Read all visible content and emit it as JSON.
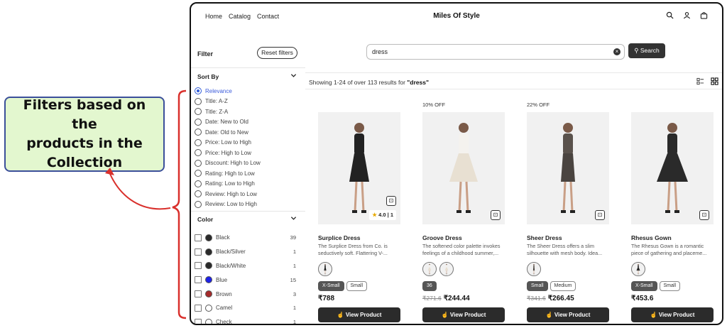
{
  "annotation": {
    "text": "Filters based on the\nproducts in the\nCollection"
  },
  "nav": {
    "links": [
      "Home",
      "Catalog",
      "Contact"
    ],
    "brand": "Miles Of Style"
  },
  "filter": {
    "label": "Filter",
    "reset": "Reset filters"
  },
  "search": {
    "query": "dress",
    "button": "Search"
  },
  "sort": {
    "title": "Sort By",
    "options": [
      "Relevance",
      "Title: A-Z",
      "Title: Z-A",
      "Date: New to Old",
      "Date: Old to New",
      "Price: Low to High",
      "Price: High to Low",
      "Discount: High to Low",
      "Rating: High to Low",
      "Rating: Low to High",
      "Review: High to Low",
      "Review: Low to High"
    ],
    "selected": "Relevance"
  },
  "color": {
    "title": "Color",
    "items": [
      {
        "name": "Black",
        "count": "39",
        "swatch": "#2a2a2a"
      },
      {
        "name": "Black/Silver",
        "count": "1",
        "swatch": "#2a2a2a"
      },
      {
        "name": "Black/White",
        "count": "1",
        "swatch": "#2a2a2a"
      },
      {
        "name": "Blue",
        "count": "15",
        "swatch": "#1e22e8"
      },
      {
        "name": "Brown",
        "count": "3",
        "swatch": "#a52a2a"
      },
      {
        "name": "Camel",
        "count": "1",
        "swatch": "#ffffff"
      },
      {
        "name": "Check",
        "count": "1",
        "swatch": "#ffffff"
      }
    ]
  },
  "results": {
    "prefix": "Showing 1-24 of over 113 results for ",
    "query": "\"dress\""
  },
  "products": [
    {
      "discount": "",
      "title": "Surplice Dress",
      "desc": "The Surplice Dress from Co. is seductively soft. Flattering V-...",
      "rating": "4.0 | 1",
      "sizes": [
        "X-Small",
        "Small"
      ],
      "selected_size": "X-Small",
      "old_price": "",
      "price": "₹788",
      "button": "View Product"
    },
    {
      "discount": "10% OFF",
      "title": "Groove Dress",
      "desc": "The softened color palette invokes feelings of a childhood summer,...",
      "rating": "",
      "sizes": [
        "36"
      ],
      "selected_size": "36",
      "old_price": "₹271.6",
      "price": "₹244.44",
      "button": "View Product"
    },
    {
      "discount": "22% OFF",
      "title": "Sheer Dress",
      "desc": "The Sheer Dress offers a slim silhouette with mesh body. Idea...",
      "rating": "",
      "sizes": [
        "Small",
        "Medium"
      ],
      "selected_size": "Small",
      "old_price": "₹341.6",
      "price": "₹266.45",
      "button": "View Product"
    },
    {
      "discount": "",
      "title": "Rhesus Gown",
      "desc": "The Rhesus Gown is a romantic piece of gathering and placeme...",
      "rating": "",
      "sizes": [
        "X-Small",
        "Small"
      ],
      "selected_size": "X-Small",
      "old_price": "",
      "price": "₹453.6",
      "button": "View Product"
    }
  ]
}
